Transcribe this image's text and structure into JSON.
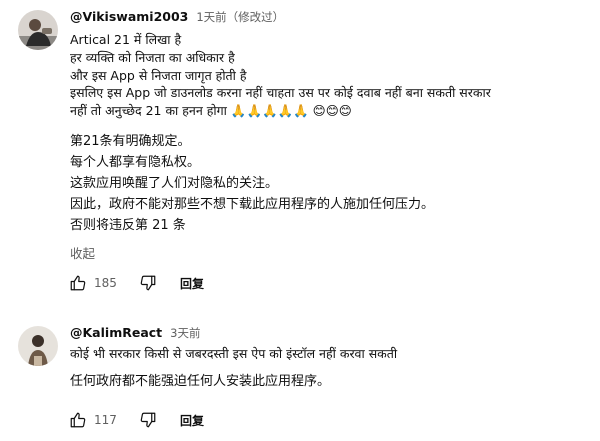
{
  "comments": [
    {
      "author": "@Vikiswami2003",
      "time": "1天前",
      "edited": "（修改过）",
      "hindi_lines": [
        "Artical 21 में लिखा है",
        "हर व्यक्ति को निजता का अधिकार है",
        "और इस App से निजता जागृत होती है",
        "इसलिए इस App जो डाउनलोड करना नहीं चाहता उस पर कोई दवाब नहीं बना सकती सरकार",
        "नहीं तो अनुच्छेद 21 का हनन होगा 🙏🙏🙏🙏🙏 😊😊😊"
      ],
      "chinese_lines": [
        "第21条有明确规定。",
        "每个人都享有隐私权。",
        "这款应用唤醒了人们对隐私的关注。",
        "因此，政府不能对那些不想下载此应用程序的人施加任何压力。",
        "否则将违反第 21 条"
      ],
      "collapse_label": "收起",
      "likes": "185",
      "reply_label": "回复"
    },
    {
      "author": "@KalimReact",
      "time": "3天前",
      "hindi_line": "कोई भी सरकार किसी से जबरदस्ती इस ऐप को इंस्टॉल नहीं करवा सकती",
      "chinese_line": "任何政府都不能强迫任何人安装此应用程序。",
      "likes": "117",
      "reply_label": "回复"
    }
  ],
  "icons": {
    "like": "thumb-up-icon",
    "dislike": "thumb-down-icon"
  },
  "colors": {
    "text": "#0f0f0f",
    "muted": "#606060"
  }
}
